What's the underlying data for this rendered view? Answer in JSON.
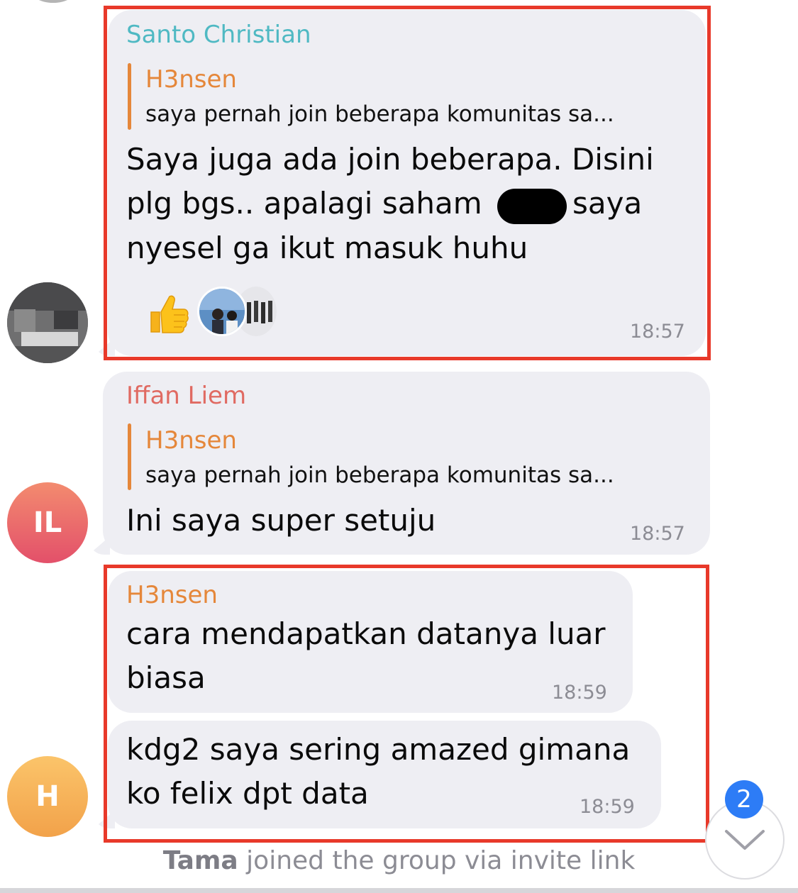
{
  "messages": [
    {
      "sender": "Santo Christian",
      "reply": {
        "name": "H3nsen",
        "text": "saya pernah join beberapa komunitas sa..."
      },
      "lines": [
        "Saya juga ada join beberapa. Disini",
        "plg bgs.. apalagi saham",
        "saya",
        "nyesel ga ikut masuk huhu"
      ],
      "time": "18:57",
      "reactions": [
        "thumbs-up-emoji",
        "reactor-avatar-photo",
        "reactor-avatar-photo"
      ]
    },
    {
      "sender": "Iffan Liem",
      "avatar_initials": "IL",
      "reply": {
        "name": "H3nsen",
        "text": "saya pernah join beberapa komunitas sa..."
      },
      "lines": [
        "Ini saya super setuju"
      ],
      "time": "18:57"
    },
    {
      "sender": "H3nsen",
      "lines": [
        "cara mendapatkan datanya luar",
        "biasa"
      ],
      "time": "18:59"
    },
    {
      "avatar_initials": "H",
      "lines": [
        "kdg2 saya sering amazed gimana",
        "ko felix dpt data"
      ],
      "time": "18:59"
    }
  ],
  "system_message": {
    "name": "Tama",
    "text": "joined the group via invite link"
  },
  "scroll_button": {
    "badge": "2",
    "icon": "chevron-down-icon"
  },
  "colors": {
    "santo": "#4fb9c3",
    "iffan": "#e06a62",
    "h3nsen": "#e5873a",
    "bubble": "#eeeef3",
    "highlight": "#e8392a",
    "badge": "#2d7cf6"
  }
}
